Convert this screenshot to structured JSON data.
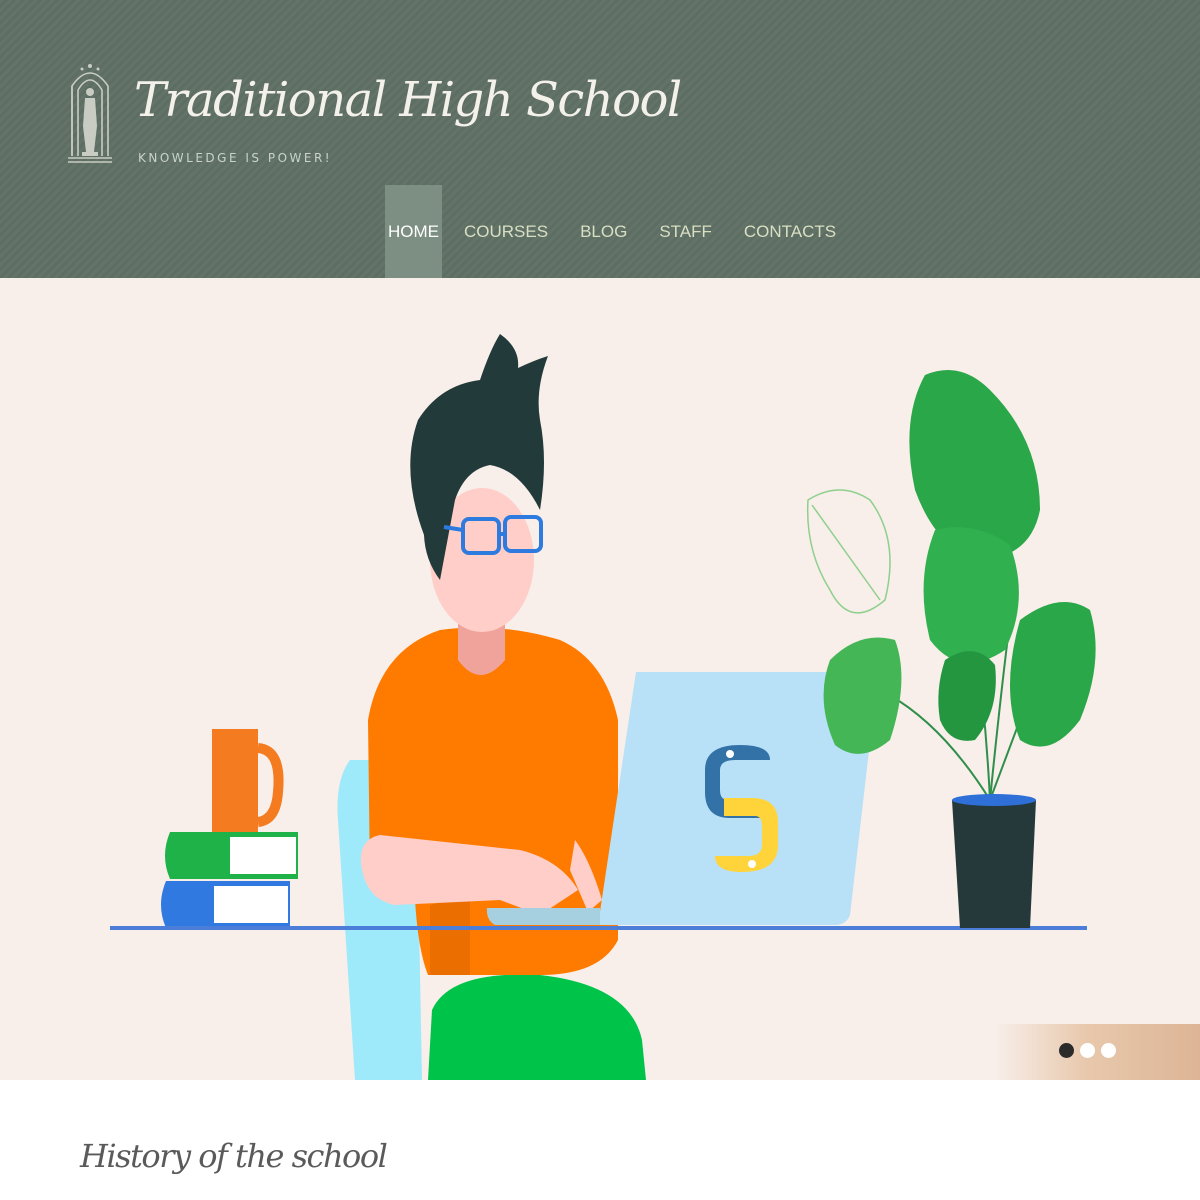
{
  "site": {
    "title": "Traditional High School",
    "tagline": "KNOWLEDGE IS POWER!"
  },
  "nav": {
    "items": [
      {
        "label": "HOME",
        "active": true
      },
      {
        "label": "COURSES",
        "active": false
      },
      {
        "label": "BLOG",
        "active": false
      },
      {
        "label": "STAFF",
        "active": false
      },
      {
        "label": "CONTACTS",
        "active": false
      }
    ]
  },
  "hero": {
    "illustration": "person-coding-python-laptop-illustration",
    "slides": 3,
    "active_slide": 1
  },
  "main": {
    "heading": "History of the school"
  },
  "colors": {
    "header_bg": "#5f7065",
    "nav_active_bg": "#7d8e82",
    "hero_bg": "#f8eeea"
  },
  "icons": {
    "logo": "statue-arch-emblem-icon",
    "python": "python-logo-icon"
  }
}
